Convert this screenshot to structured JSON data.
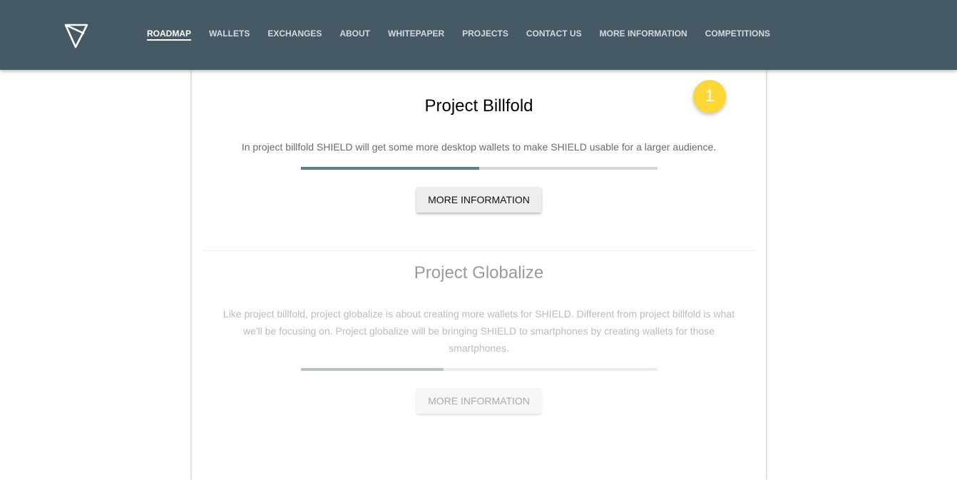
{
  "nav": {
    "logo_icon": "shield-triangle-logo",
    "items": [
      {
        "label": "ROADMAP",
        "active": true
      },
      {
        "label": "WALLETS",
        "active": false
      },
      {
        "label": "EXCHANGES",
        "active": false
      },
      {
        "label": "ABOUT",
        "active": false
      },
      {
        "label": "WHITEPAPER",
        "active": false
      },
      {
        "label": "PROJECTS",
        "active": false
      },
      {
        "label": "CONTACT US",
        "active": false
      },
      {
        "label": "MORE INFORMATION",
        "active": false
      },
      {
        "label": "COMPETITIONS",
        "active": false
      }
    ]
  },
  "badge": {
    "value": "1"
  },
  "projects": [
    {
      "title": "Project Billfold",
      "description": "In project billfold SHIELD will get some more desktop wallets to make SHIELD usable for a larger audience.",
      "progress_fraction": 0.5,
      "button_label": "MORE INFORMATION"
    },
    {
      "title": "Project Globalize",
      "description": "Like project billfold, project globalize is about creating more wallets for SHIELD. Different from project billfold is what we'll be focusing on. Project globalize will be bringing SHIELD to smartphones by creating wallets for those smartphones.",
      "progress_fraction": 0.4,
      "button_label": "MORE INFORMATION"
    }
  ],
  "colors": {
    "navbar": "#455a64",
    "progress_track": "#cfd8dc",
    "progress_fill": "#607d8b",
    "badge": "#fdd835"
  }
}
